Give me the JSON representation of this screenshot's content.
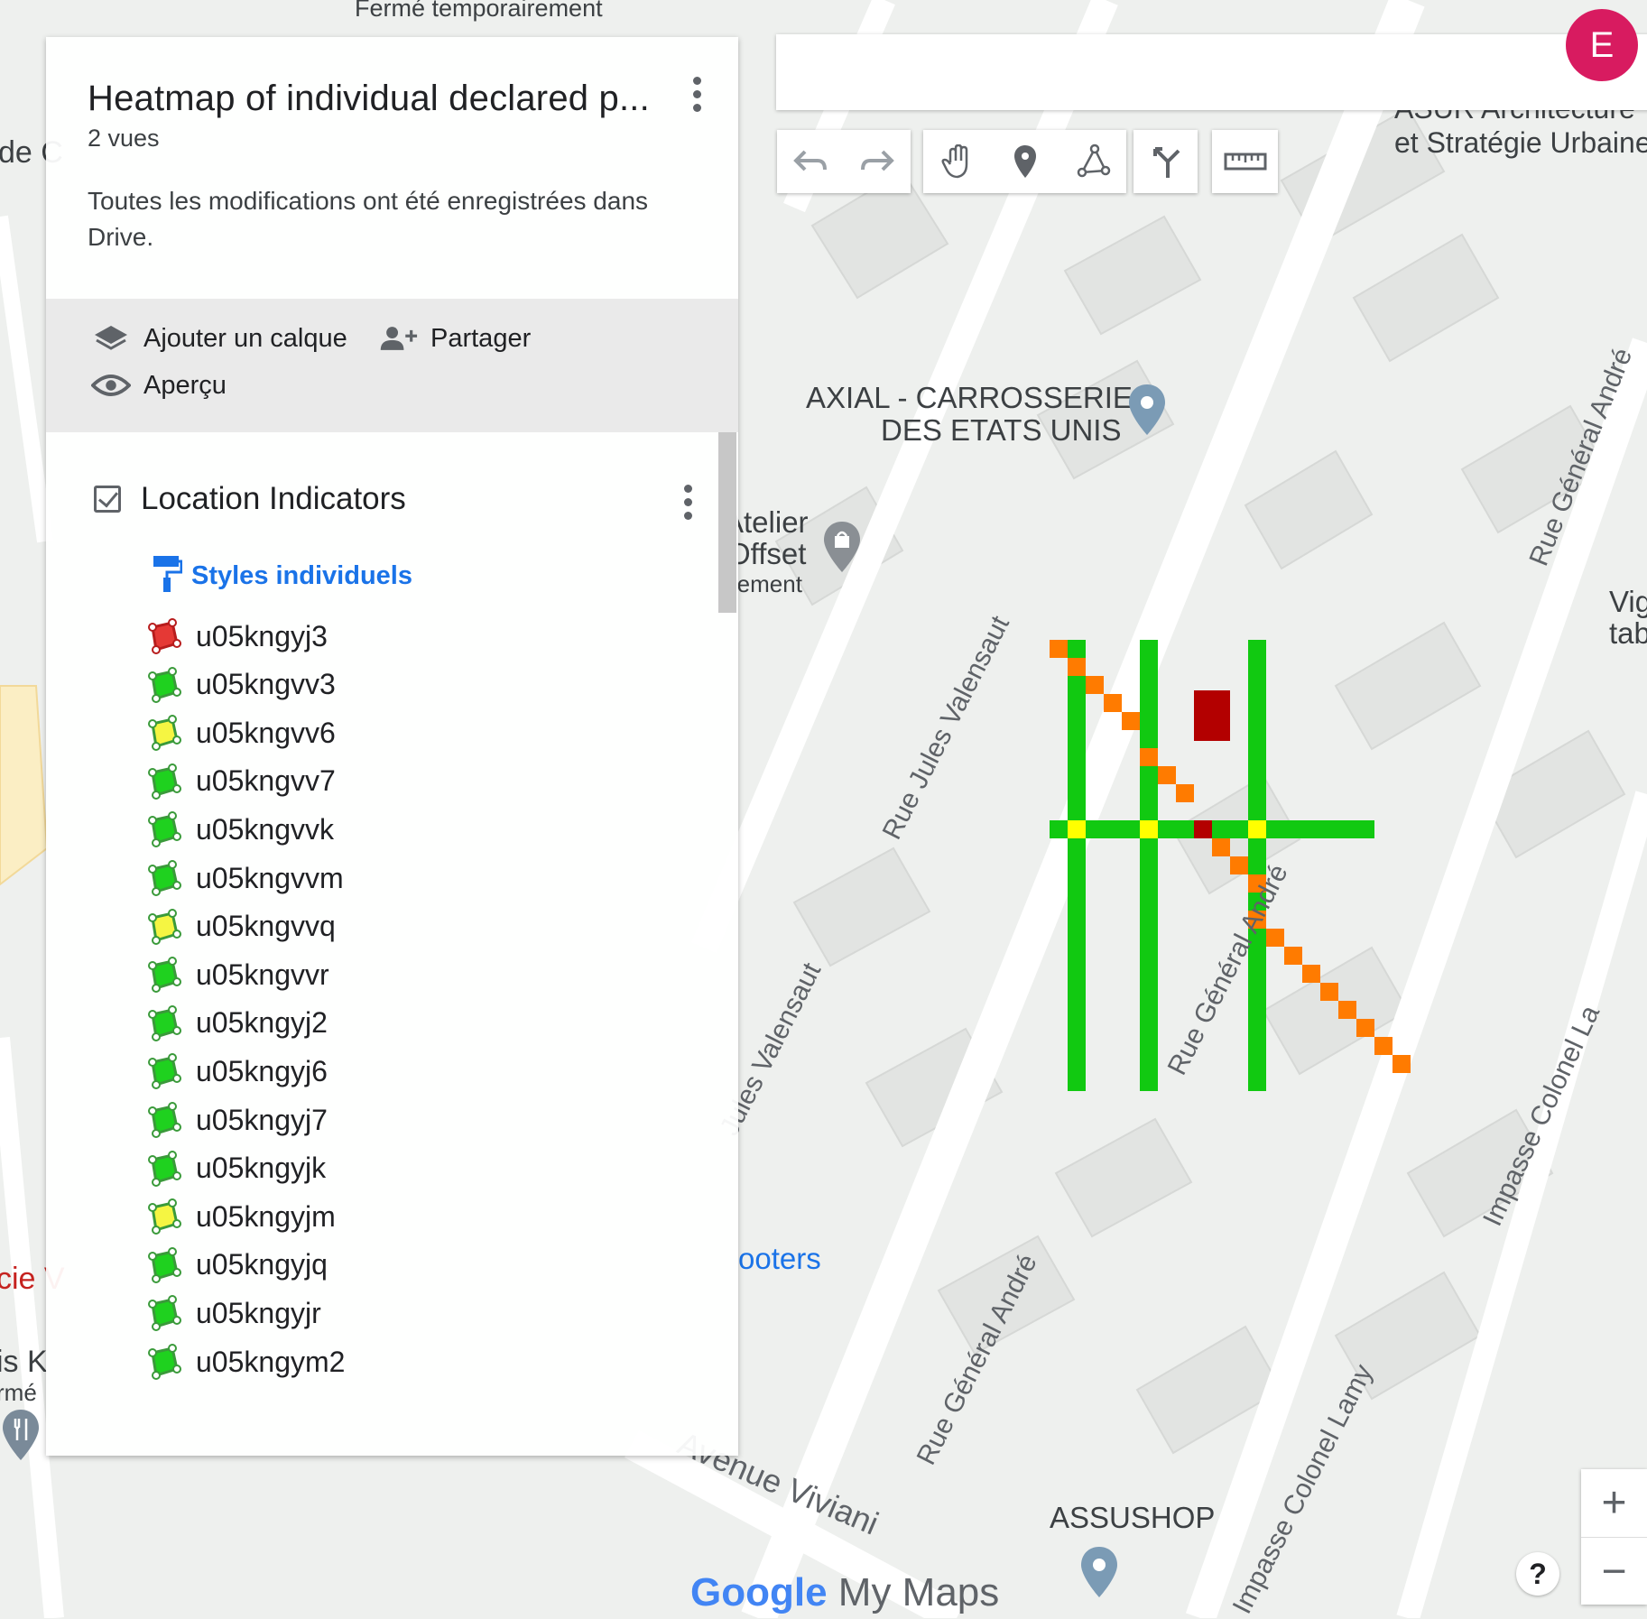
{
  "app": {
    "brand": "Google My Maps",
    "avatar_letter": "E"
  },
  "panel": {
    "title": "Heatmap of individual declared p...",
    "views": "2 vues",
    "saved_status": "Toutes les modifications ont été enregistrées dans Drive.",
    "add_layer": "Ajouter un calque",
    "share": "Partager",
    "preview": "Aperçu"
  },
  "layer": {
    "title": "Location Indicators",
    "checked": true,
    "styles_link": "Styles individuels",
    "items": [
      {
        "label": "u05kngyj3",
        "color": "#e53935"
      },
      {
        "label": "u05kngvv3",
        "color": "#1fd11f"
      },
      {
        "label": "u05kngvv6",
        "color": "#f5f542"
      },
      {
        "label": "u05kngvv7",
        "color": "#1fd11f"
      },
      {
        "label": "u05kngvvk",
        "color": "#1fd11f"
      },
      {
        "label": "u05kngvvm",
        "color": "#1fd11f"
      },
      {
        "label": "u05kngvvq",
        "color": "#f5f542"
      },
      {
        "label": "u05kngvvr",
        "color": "#1fd11f"
      },
      {
        "label": "u05kngyj2",
        "color": "#1fd11f"
      },
      {
        "label": "u05kngyj6",
        "color": "#1fd11f"
      },
      {
        "label": "u05kngyj7",
        "color": "#1fd11f"
      },
      {
        "label": "u05kngyjk",
        "color": "#1fd11f"
      },
      {
        "label": "u05kngyjm",
        "color": "#f5f542"
      },
      {
        "label": "u05kngyjq",
        "color": "#1fd11f"
      },
      {
        "label": "u05kngyjr",
        "color": "#1fd11f"
      },
      {
        "label": "u05kngym2",
        "color": "#1fd11f"
      }
    ]
  },
  "map": {
    "top_text": "Fermé temporairement",
    "poi_axial": "AXIAL - CARROSSERIE DES ETATS UNIS",
    "poi_axial_line1": "AXIAL - CARROSSERIE",
    "poi_axial_line2": "DES ETATS UNIS",
    "poi_atelier_1": "Atelier",
    "poi_atelier_2": "Offset",
    "poi_atelier_3": "rement",
    "poi_footers": "ooters",
    "poi_assushop": "ASSUSHOP",
    "poi_asur_1": "ASUR Architecture",
    "poi_asur_2": "et Stratégie Urbaine",
    "street_valensaut_1": "Rue Jules Valensaut",
    "street_valensaut_2": "Jules Valensaut",
    "street_andre_1": "Rue Général André",
    "street_andre_2": "Rue Général André",
    "street_andre_3": "Rue Général André",
    "street_viviani": "Avenue Viviani",
    "street_lamy_1": "Impasse Colonel Lamy",
    "street_lamy_2": "Impasse Colonel La",
    "left_edge_1": "de C",
    "left_edge_2": "cie V",
    "left_edge_3": "is K",
    "left_edge_4": "rmé",
    "right_edge_1": "Vig",
    "right_edge_2": "tab",
    "zoom_in": "+",
    "zoom_out": "−",
    "help": "?"
  },
  "colors": {
    "green": "#11c911",
    "orange": "#ff7b00",
    "yellow": "#ffff00",
    "darkred": "#b30000",
    "accent": "#1a73e8"
  }
}
